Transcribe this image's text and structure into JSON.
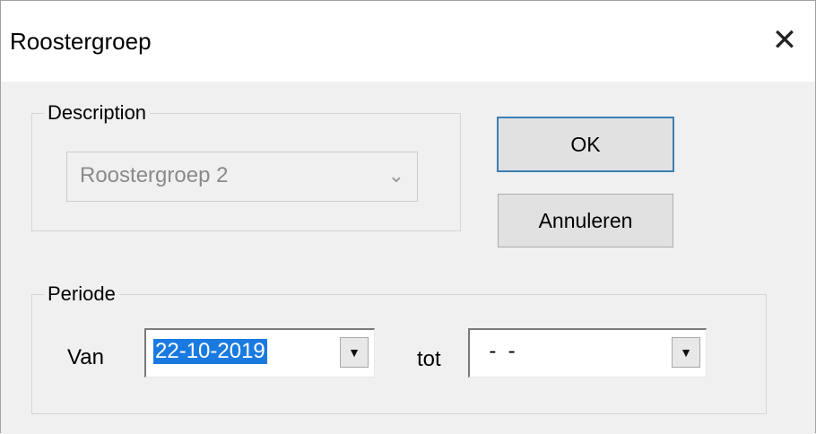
{
  "window": {
    "title": "Roostergroep",
    "close_glyph": "✕"
  },
  "description": {
    "group_label": "Description",
    "value": "Roostergroep 2",
    "dropdown_glyph": "⌄"
  },
  "buttons": {
    "ok_label": "OK",
    "cancel_label": "Annuleren"
  },
  "periode": {
    "group_label": "Periode",
    "from_label": "Van",
    "from_value": "22-10-2019",
    "to_label": "tot",
    "to_value": "  -  -",
    "dropdown_glyph": "▼"
  },
  "colors": {
    "accent_focus": "#3c7fb1",
    "selection": "#1a7ae0"
  }
}
